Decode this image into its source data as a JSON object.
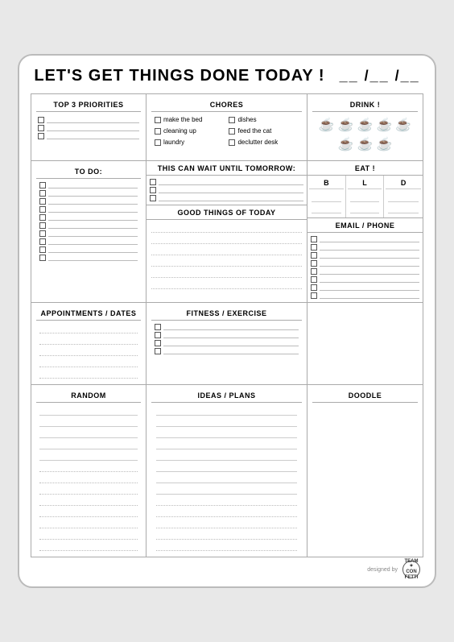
{
  "header": {
    "title": "LET'S GET THINGS DONE TODAY !",
    "date_placeholder": "__ /__ /__"
  },
  "sections": {
    "top3_label": "TOP 3 PRIORITIES",
    "chores_label": "CHORES",
    "drink_label": "DRINK !",
    "todo_label": "TO DO:",
    "wait_label": "THIS CAN WAIT UNTIL TOMORROW:",
    "eat_label": "EAT !",
    "good_label": "GOOD THINGS OF TODAY",
    "email_label": "EMAIL / PHONE",
    "appt_label": "APPOINTMENTS / DATES",
    "fitness_label": "FITNESS / EXERCISE",
    "random_label": "RANDOM",
    "ideas_label": "IDEAS / PLANS",
    "doodle_label": "DOODLE",
    "eat_cols": [
      "B",
      "L",
      "D"
    ]
  },
  "chores_items": [
    "make the bed",
    "dishes",
    "cleaning up",
    "feed the cat",
    "laundry",
    "declutter desk"
  ],
  "footer": {
    "designed_by": "designed by",
    "brand": "TEAM\n✦\nCONFETTI"
  }
}
